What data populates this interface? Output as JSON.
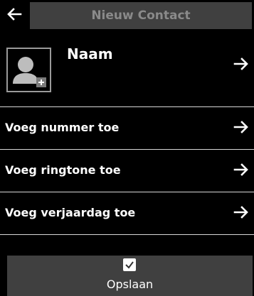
{
  "header": {
    "back_icon": "arrow-left-icon",
    "title": "Nieuw Contact"
  },
  "contact": {
    "avatar_icon": "contact-avatar-add-icon",
    "name_label": "Naam",
    "arrow_icon": "arrow-right-icon"
  },
  "menu": {
    "items": [
      {
        "label": "Voeg nummer toe",
        "icon": "arrow-right-icon"
      },
      {
        "label": "Voeg ringtone toe",
        "icon": "arrow-right-icon"
      },
      {
        "label": "Voeg verjaardag toe",
        "icon": "arrow-right-icon"
      }
    ]
  },
  "footer": {
    "check_icon": "checkmark-icon",
    "save_label": "Opslaan"
  },
  "colors": {
    "background": "#000000",
    "bar": "#404040",
    "title_text": "#8a8a8a",
    "divider": "#d8d8d8"
  }
}
